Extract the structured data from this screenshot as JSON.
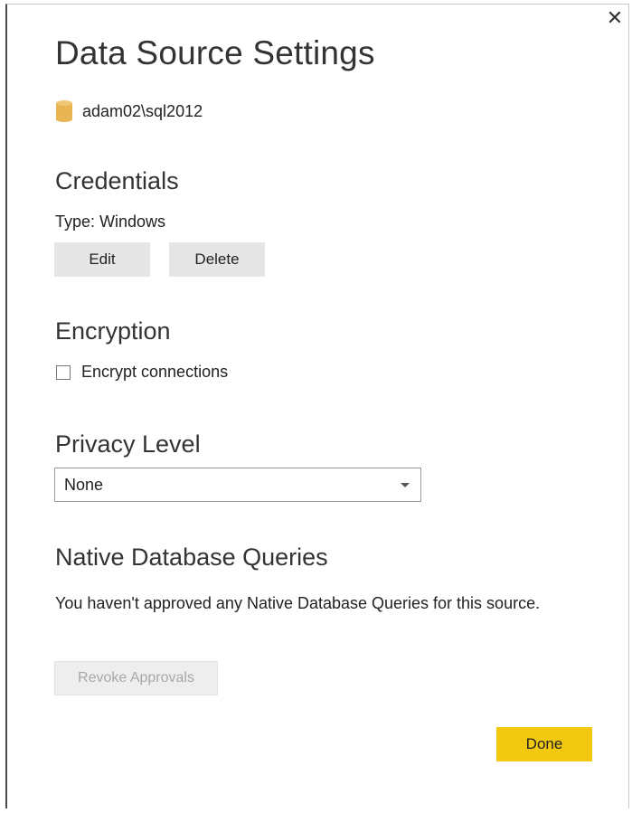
{
  "dialog": {
    "title": "Data Source Settings",
    "close_glyph": "✕",
    "source": {
      "icon": "database-icon",
      "name": "adam02\\sql2012"
    },
    "credentials": {
      "heading": "Credentials",
      "type_text": "Type: Windows",
      "edit_label": "Edit",
      "delete_label": "Delete"
    },
    "encryption": {
      "heading": "Encryption",
      "checkbox_label": "Encrypt connections",
      "checked": false
    },
    "privacy": {
      "heading": "Privacy Level",
      "selected": "None"
    },
    "native_queries": {
      "heading": "Native Database Queries",
      "message": "You haven't approved any Native Database Queries for this source.",
      "revoke_label": "Revoke Approvals"
    },
    "done_label": "Done"
  },
  "colors": {
    "accent": "#f2c811",
    "button_bg": "#e6e6e6",
    "disabled_text": "#a8a8a8",
    "db_icon": "#e8b454"
  }
}
